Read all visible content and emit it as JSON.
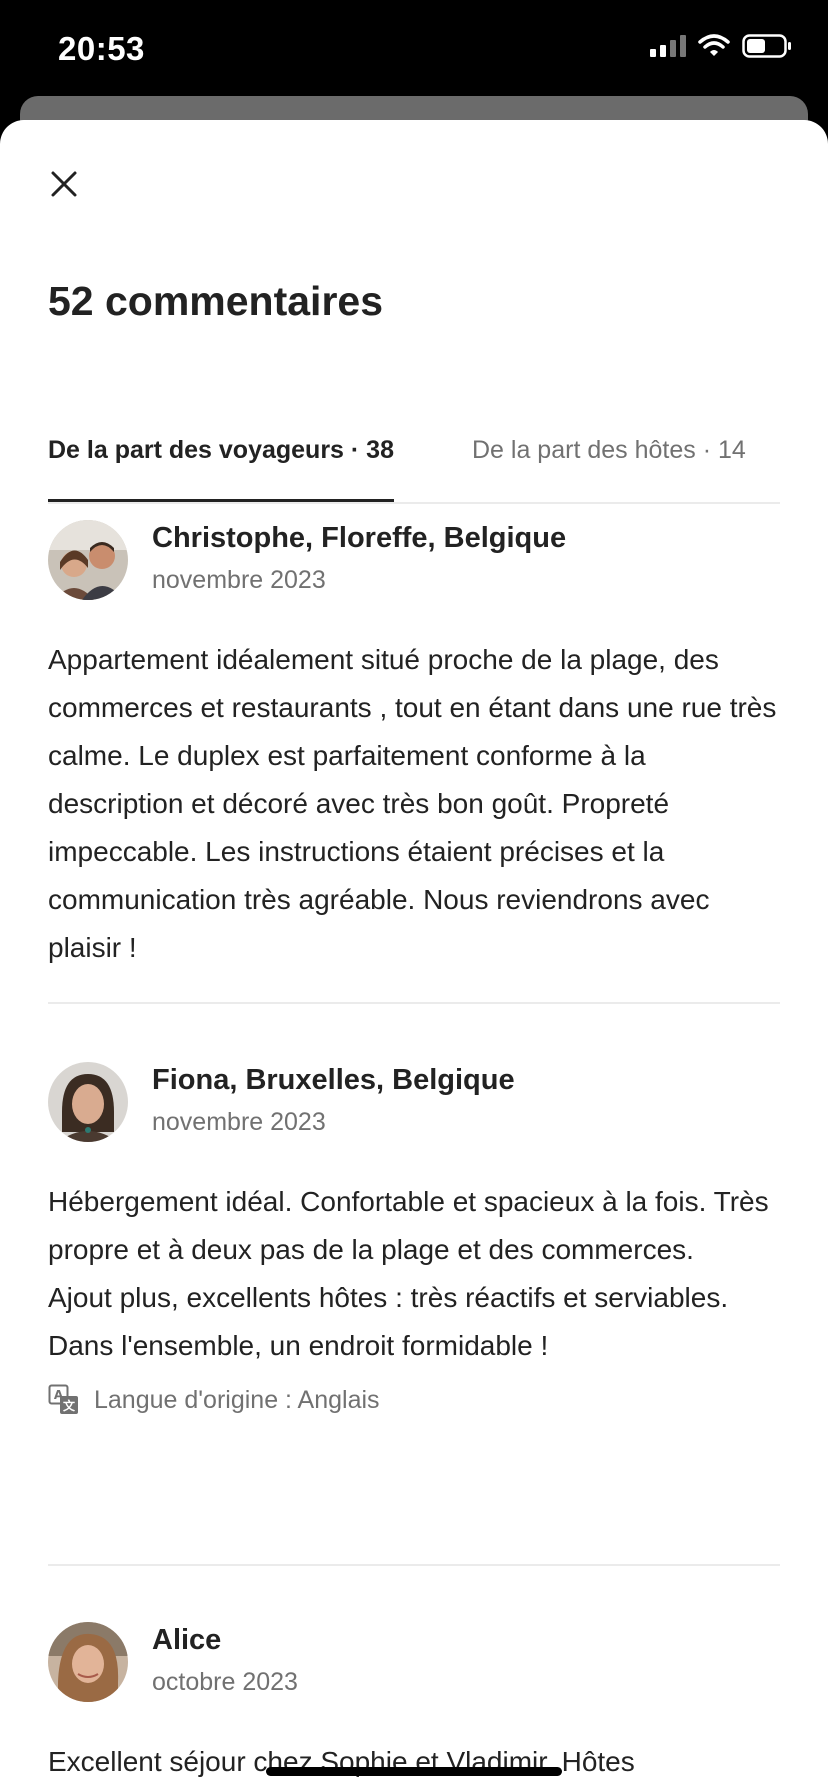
{
  "status_bar": {
    "time": "20:53"
  },
  "sheet": {
    "title": "52 commentaires",
    "tabs": [
      {
        "label": "De la part des voyageurs · 38",
        "active": true
      },
      {
        "label": "De la part des hôtes · 14",
        "active": false
      }
    ]
  },
  "reviews": [
    {
      "name": "Christophe, Floreffe, Belgique",
      "date": "novembre 2023",
      "text": [
        "Appartement idéalement situé proche de la plage, des commerces et restaurants , tout en étant dans une rue très calme.  Le duplex est parfaitement conforme à la description et décoré avec très bon goût. Propreté impeccable. Les instructions étaient précises et la communication très agréable. Nous reviendrons avec plaisir !"
      ]
    },
    {
      "name": "Fiona, Bruxelles, Belgique",
      "date": "novembre 2023",
      "text": [
        "Hébergement idéal. Confortable et spacieux à la fois. Très propre et à deux pas de la plage et des commerces.",
        "Ajout plus, excellents hôtes : très réactifs et serviables.",
        "Dans l'ensemble, un endroit formidable !"
      ],
      "translation_note": "Langue d'origine : Anglais"
    },
    {
      "name": "Alice",
      "date": "octobre 2023",
      "text": [
        "Excellent séjour chez Sophie et Vladimir. Hôtes"
      ]
    }
  ],
  "icons": {
    "close": "close-icon",
    "translate": "translate-icon",
    "signal": "cellular-signal-icon",
    "wifi": "wifi-icon",
    "battery": "battery-icon"
  }
}
